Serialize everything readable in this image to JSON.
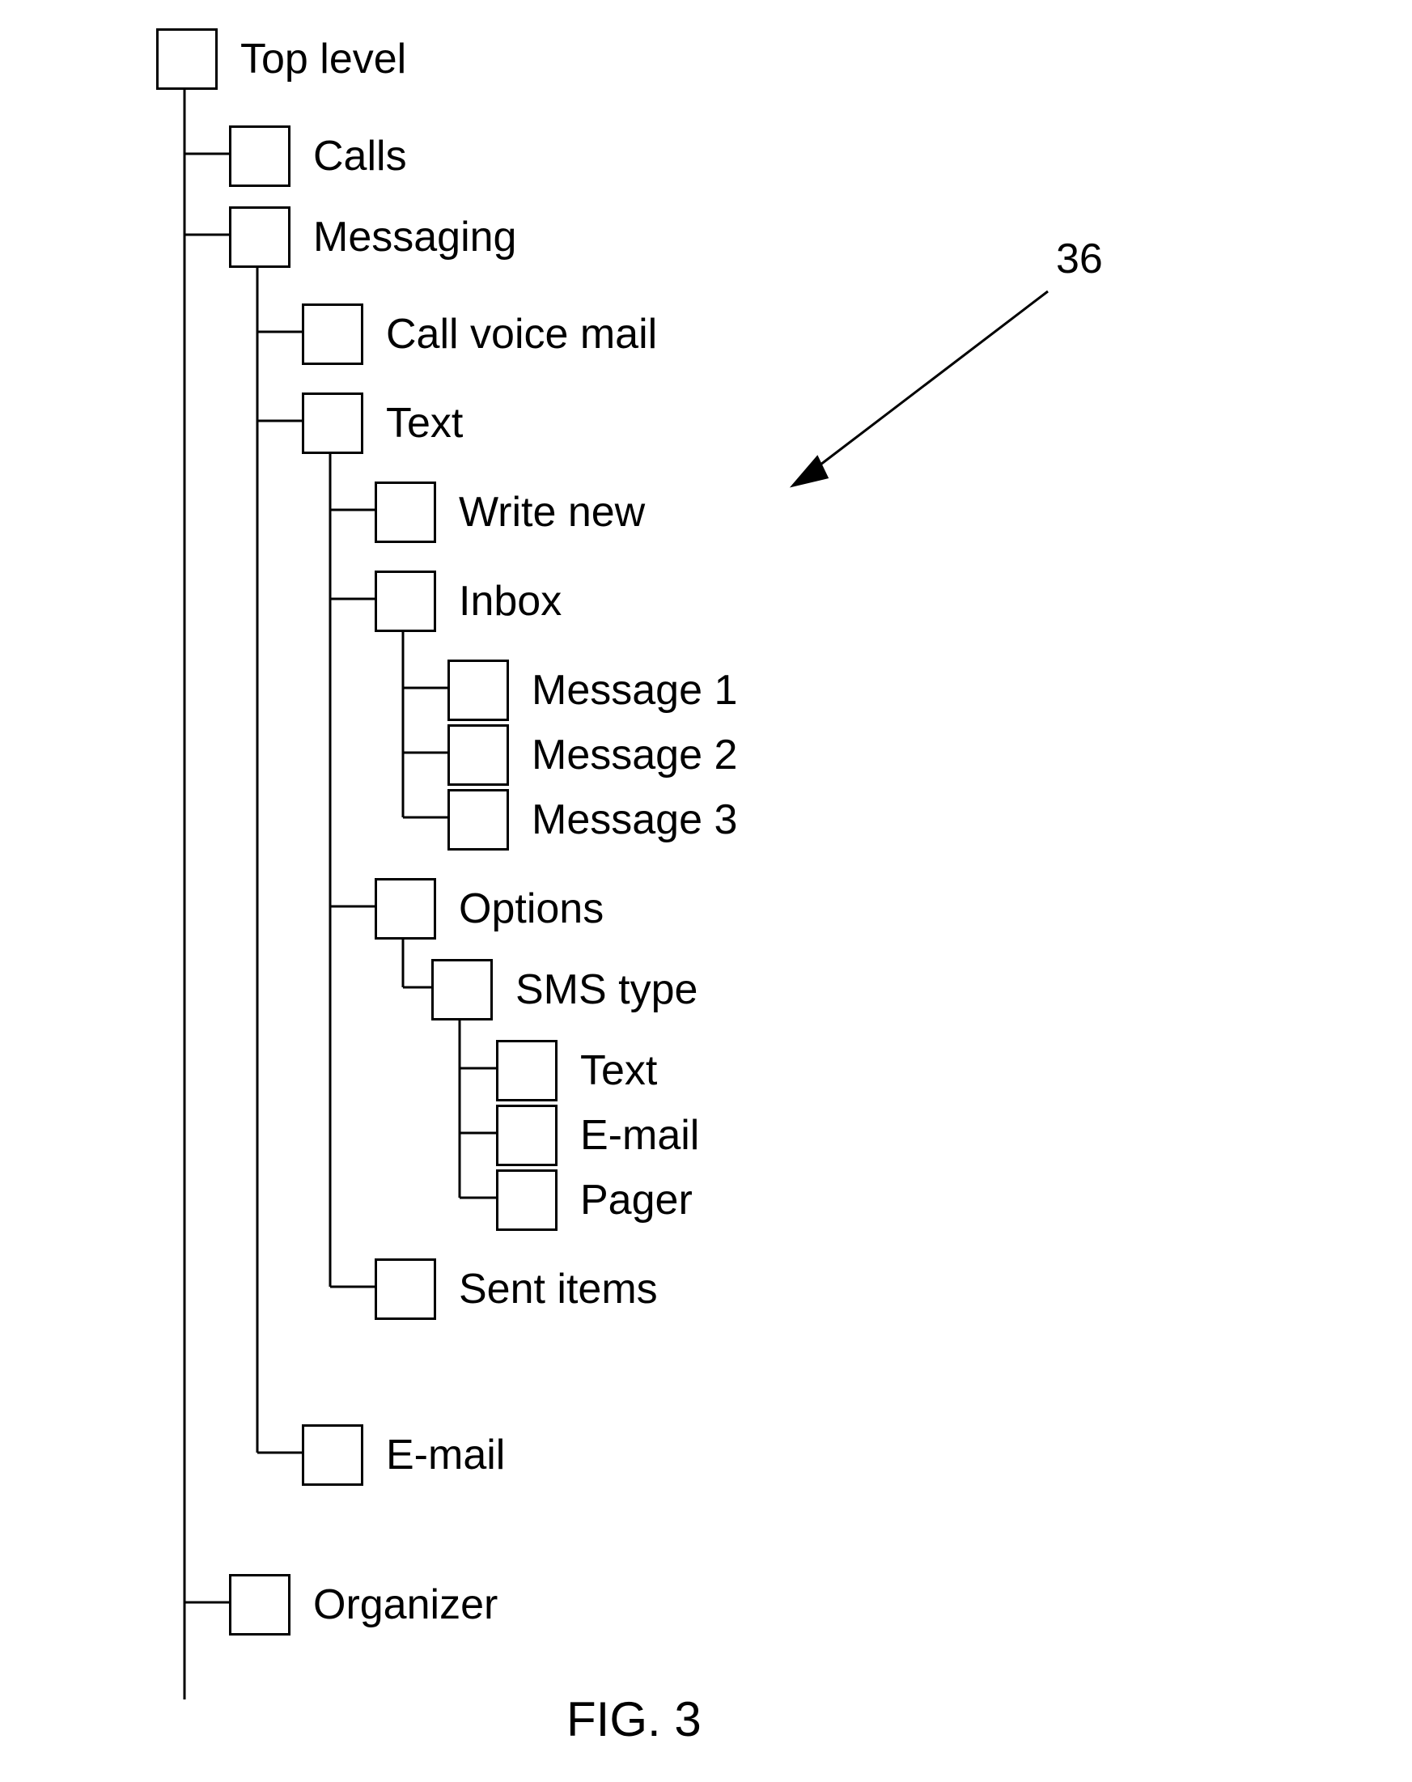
{
  "reference_number": "36",
  "figure_caption": "FIG. 3",
  "tree": {
    "top_level": "Top level",
    "calls": "Calls",
    "messaging": "Messaging",
    "call_voice_mail": "Call voice mail",
    "text": "Text",
    "write_new": "Write new",
    "inbox": "Inbox",
    "message_1": "Message 1",
    "message_2": "Message 2",
    "message_3": "Message 3",
    "options": "Options",
    "sms_type": "SMS type",
    "sms_text": "Text",
    "sms_email": "E-mail",
    "sms_pager": "Pager",
    "sent_items": "Sent items",
    "email": "E-mail",
    "organizer": "Organizer"
  }
}
